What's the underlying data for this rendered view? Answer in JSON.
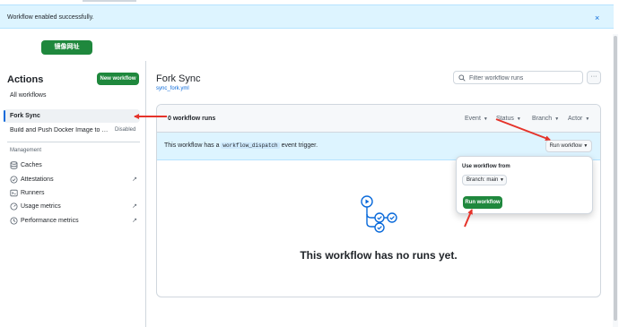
{
  "flash": {
    "message": "Workflow enabled successfully.",
    "close_icon": "×"
  },
  "top_button": {
    "label": "镜像网址"
  },
  "sidebar": {
    "title": "Actions",
    "new_workflow": "New workflow",
    "all_workflows": "All workflows",
    "workflows": [
      {
        "label": "Fork Sync",
        "selected": true
      },
      {
        "label": "Build and Push Docker Image to Do...",
        "badge": "Disabled"
      }
    ],
    "management_heading": "Management",
    "management": [
      {
        "label": "Caches",
        "icon": "caches-icon",
        "external": ""
      },
      {
        "label": "Attestations",
        "icon": "attestations-icon",
        "external": "↗"
      },
      {
        "label": "Runners",
        "icon": "runners-icon",
        "external": ""
      },
      {
        "label": "Usage metrics",
        "icon": "usage-metrics-icon",
        "external": "↗"
      },
      {
        "label": "Performance metrics",
        "icon": "performance-metrics-icon",
        "external": "↗"
      }
    ]
  },
  "main": {
    "title": "Fork Sync",
    "file": "sync_fork.yml",
    "filter_placeholder": "Filter workflow runs",
    "more_label": "···",
    "runs_count": "0 workflow runs",
    "filters": [
      "Event",
      "Status",
      "Branch",
      "Actor"
    ],
    "dispatch": {
      "prefix": "This workflow has a",
      "code": "workflow_dispatch",
      "suffix": "event trigger.",
      "button": "Run workflow"
    },
    "empty_title": "This workflow has no runs yet."
  },
  "popover": {
    "label": "Use workflow from",
    "branch": "Branch: main",
    "run_button": "Run workflow"
  },
  "colors": {
    "primary_green": "#1f883d",
    "link_blue": "#0969da",
    "annotation_red": "#e5332a",
    "flash_bg": "#ddf4ff"
  }
}
